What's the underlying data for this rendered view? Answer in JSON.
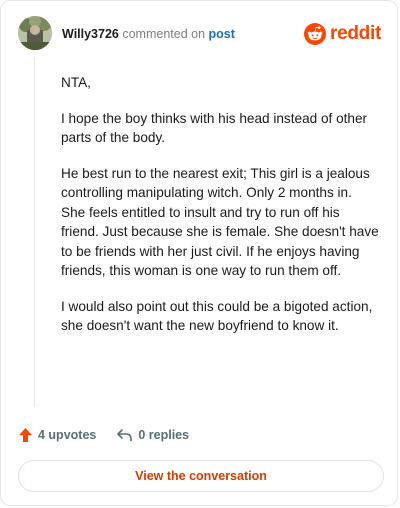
{
  "header": {
    "username": "Willy3726",
    "commented_text": "commented on",
    "post_link": "post",
    "brand_word": "reddit",
    "brand_color": "#ff4500"
  },
  "avatar": {
    "icon": "user-avatar"
  },
  "comment": {
    "paragraphs": [
      "NTA,",
      "I hope the boy thinks with his head instead of other parts of the body.",
      "He best run to the nearest exit; This girl is a jealous controlling manipulating witch. Only 2 months in. She feels entitled to insult and try to run off his friend. Just because she is female. She doesn't have to be friends with her just civil. If he enjoys having friends, this woman is one way to run them off.",
      "I would also point out this could be a bigoted action, she doesn't want the new boyfriend to know it."
    ]
  },
  "actions": {
    "upvotes": "4 upvotes",
    "replies": "0 replies",
    "upvote_icon": "upvote-arrow-icon",
    "reply_icon": "reply-arrow-icon",
    "upvote_color": "#ff4500"
  },
  "footer": {
    "view_label": "View the conversation"
  }
}
